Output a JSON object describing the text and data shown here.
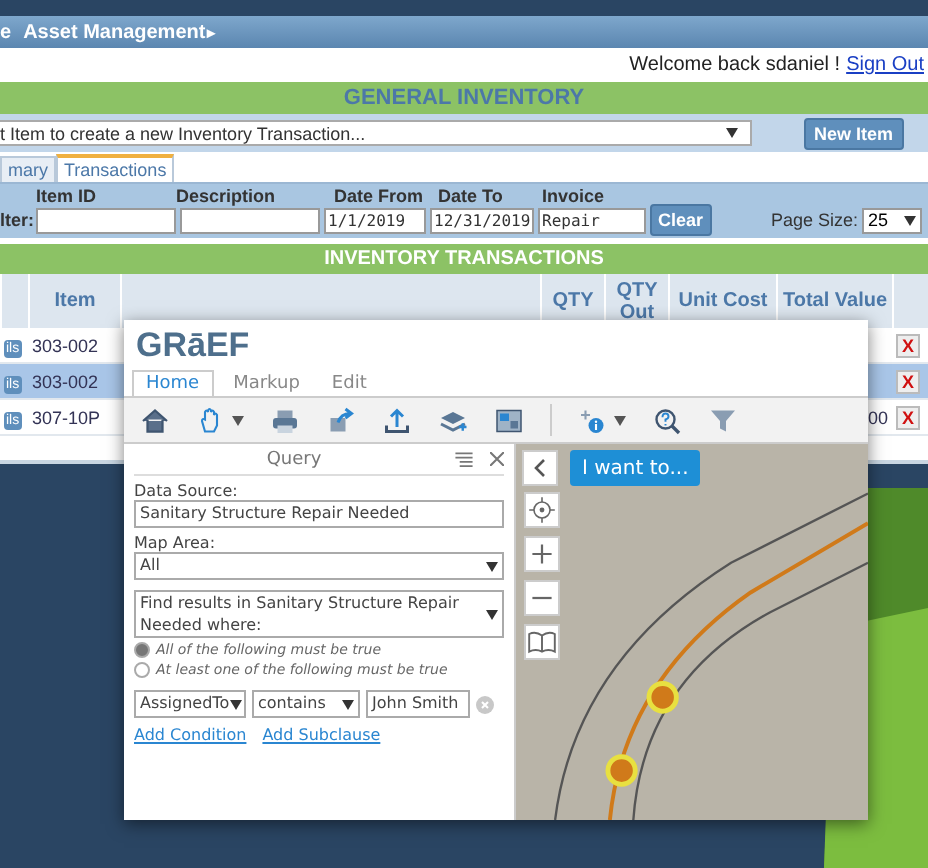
{
  "back_window": {
    "header": {
      "cut_text": "e",
      "title": "Asset Management",
      "arrow": "▸"
    },
    "welcome": {
      "text": "Welcome back sdaniel !",
      "link": "Sign Out"
    },
    "banner": "GENERAL INVENTORY",
    "item_select": {
      "value": "t Item to create a new Inventory Transaction..."
    },
    "new_item_button": "New Item",
    "tabs": [
      {
        "label": "mary",
        "selected": false
      },
      {
        "label": "Transactions",
        "selected": true
      }
    ],
    "filters": {
      "label": "lter:",
      "fields": [
        {
          "heading": "Item ID"
        },
        {
          "heading": "Description"
        },
        {
          "heading": "Date From",
          "value": "1/1/2019"
        },
        {
          "heading": "Date To",
          "value": "12/31/2019"
        },
        {
          "heading": "Invoice",
          "value": "Repair"
        }
      ],
      "clear_button": "Clear",
      "page_size": {
        "label": "Page Size:",
        "value": "25"
      }
    },
    "table": {
      "title": "INVENTORY TRANSACTIONS",
      "columns": [
        "Item",
        "QTY",
        "QTY Out",
        "Unit Cost",
        "Total Value"
      ],
      "rows": [
        {
          "details": "ils",
          "item": "303-002",
          "selected": false,
          "delete": "X"
        },
        {
          "details": "ils",
          "item": "303-002",
          "selected": true,
          "delete": "X"
        },
        {
          "details": "ils",
          "item": "307-10P",
          "selected": false,
          "total": "00",
          "delete": "X"
        }
      ]
    }
  },
  "front_window": {
    "logo": "GRāEF",
    "tabs": [
      {
        "label": "Home",
        "selected": true
      },
      {
        "label": "Markup",
        "selected": false
      },
      {
        "label": "Edit",
        "selected": false
      }
    ],
    "query": {
      "title": "Query",
      "data_source": {
        "label": "Data Source:",
        "value": "Sanitary Structure Repair Needed"
      },
      "map_area": {
        "label": "Map Area:",
        "value": "All"
      },
      "find_select": "Find results in Sanitary Structure Repair Needed where:",
      "options": [
        {
          "label": "All of the following must be true",
          "selected": true
        },
        {
          "label": "At least one of the following must be true",
          "selected": false
        }
      ],
      "condition": {
        "field": "AssignedTo",
        "operator": "contains",
        "value": "John Smith"
      },
      "links": [
        "Add Condition",
        "Add Subclause"
      ]
    },
    "map": {
      "i_want_to_button": "I want to..."
    }
  }
}
